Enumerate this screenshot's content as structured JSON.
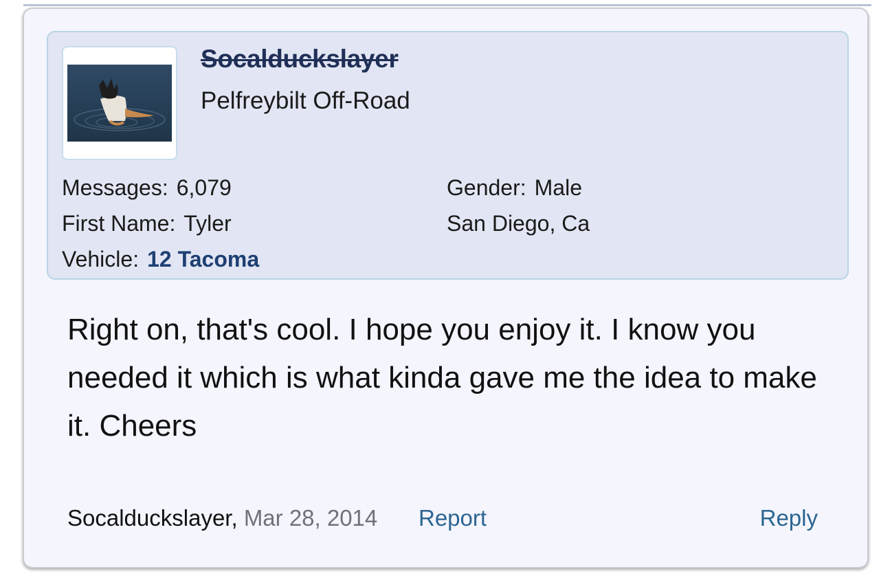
{
  "post": {
    "author": {
      "username": "Socalduckslayer",
      "title": "Pelfreybilt Off-Road",
      "avatar_alt": "duck-diving-avatar"
    },
    "info": {
      "messages_label": "Messages:",
      "messages_value": "6,079",
      "first_name_label": "First Name:",
      "first_name_value": "Tyler",
      "vehicle_label": "Vehicle:",
      "vehicle_value": "12 Tacoma",
      "gender_label": "Gender:",
      "gender_value": "Male",
      "location": "San Diego, Ca"
    },
    "message": "Right on, that's cool. I hope you enjoy it. I know you needed it which is what kinda gave me the idea to make it. Cheers",
    "footer": {
      "author": "Socalduckslayer,",
      "date": "Mar 28, 2014",
      "report_label": "Report",
      "reply_label": "Reply"
    }
  },
  "colors": {
    "card_bg": "#f4f5fd",
    "panel_bg": "#e2e5f3",
    "username": "#1f2f57",
    "link": "#2c6591",
    "vehicle_link": "#1e3f73"
  }
}
